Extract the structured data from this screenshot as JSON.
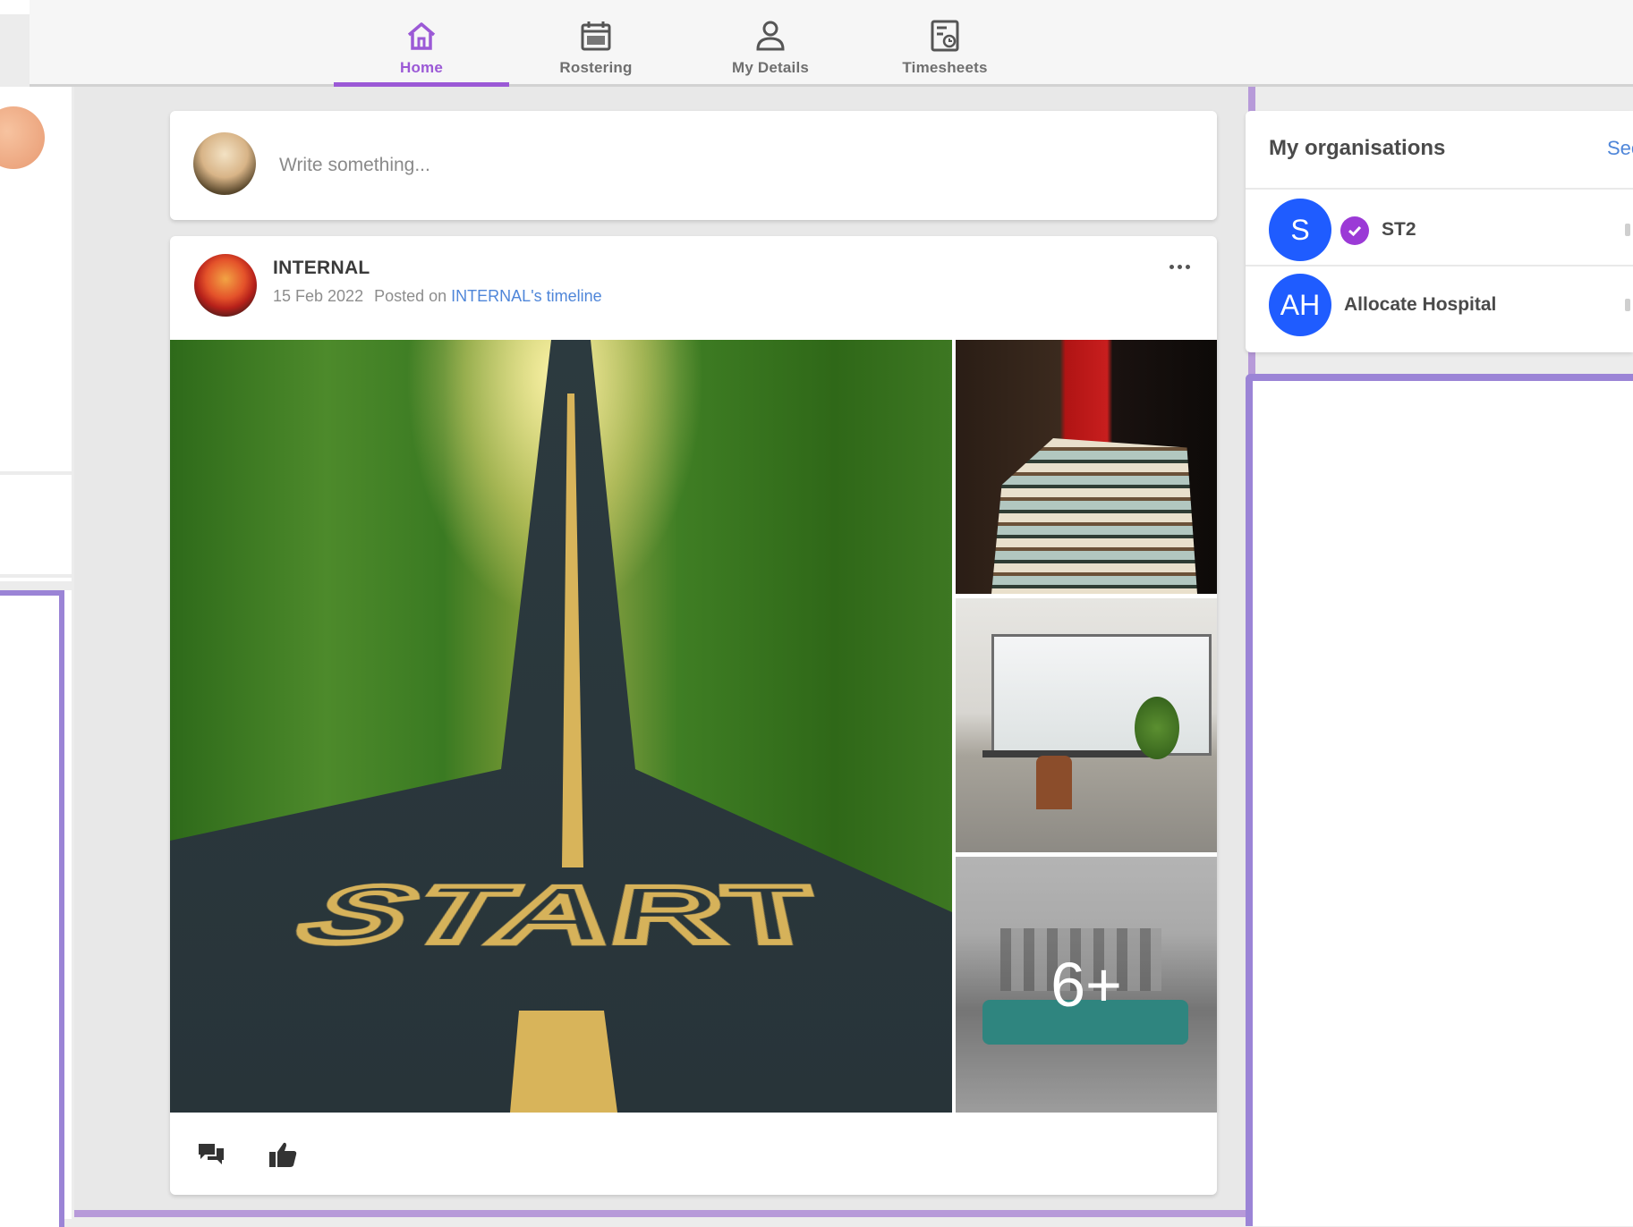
{
  "nav": {
    "tabs": [
      {
        "label": "Home",
        "icon": "home-icon",
        "active": true
      },
      {
        "label": "Rostering",
        "icon": "calendar-icon",
        "active": false
      },
      {
        "label": "My Details",
        "icon": "person-icon",
        "active": false
      },
      {
        "label": "Timesheets",
        "icon": "timesheet-icon",
        "active": false
      }
    ]
  },
  "composer": {
    "placeholder": "Write something..."
  },
  "post": {
    "author": "INTERNAL",
    "date": "15 Feb 2022",
    "posted_on_prefix": "Posted on",
    "timeline_link": "INTERNAL's timeline",
    "gallery": {
      "main_image": "road-start-image",
      "more_count": "6+"
    },
    "actions": [
      {
        "icon": "comment-icon"
      },
      {
        "icon": "thumbs-up-icon"
      }
    ]
  },
  "organisations": {
    "title": "My organisations",
    "see_all": "See all",
    "items": [
      {
        "initials": "S",
        "name": "ST2",
        "verified": true
      },
      {
        "initials": "AH",
        "name": "Allocate Hospital",
        "verified": false
      }
    ]
  },
  "colors": {
    "accent": "#9b59d6",
    "link": "#4f86d9",
    "org_avatar": "#1f5cff",
    "verified_badge": "#9b3ad6"
  }
}
